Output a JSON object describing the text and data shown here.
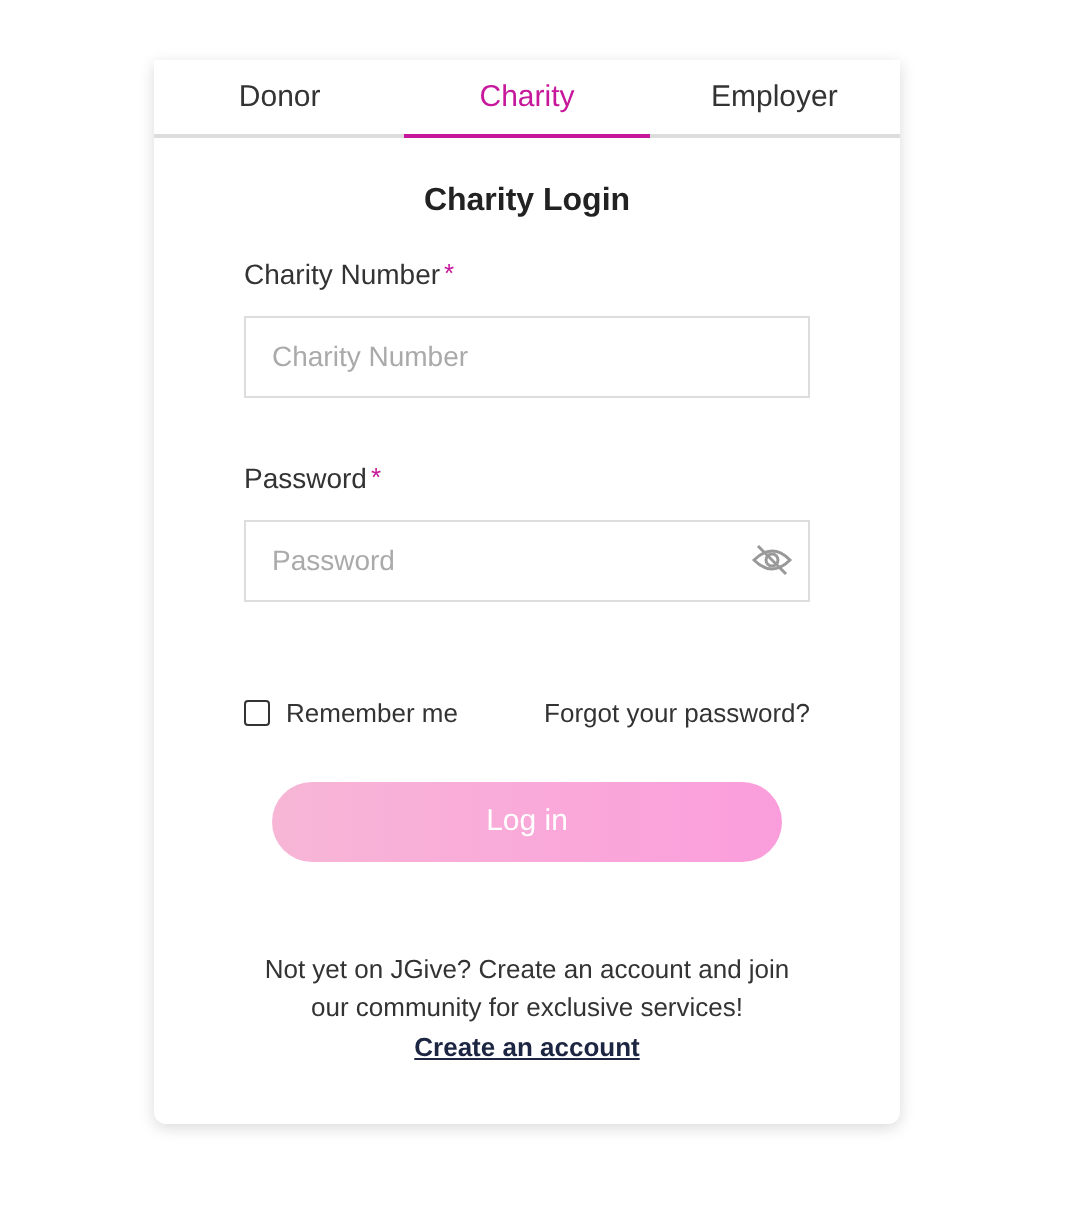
{
  "tabs": [
    {
      "label": "Donor",
      "selected": false
    },
    {
      "label": "Charity",
      "selected": true
    },
    {
      "label": "Employer",
      "selected": false
    }
  ],
  "title": "Charity Login",
  "fields": [
    {
      "label": "Charity Number",
      "required_mark": "*",
      "placeholder": "Charity Number",
      "kind": "text"
    },
    {
      "label": "Password",
      "required_mark": "*",
      "placeholder": "Password",
      "kind": "password"
    }
  ],
  "remember": {
    "label": "Remember me",
    "checked": false
  },
  "forgot_link": "Forgot your password?",
  "login_button": {
    "label": "Log in",
    "disabled": true
  },
  "signup_text": "Not yet on JGive? Create an account and join our community for exclusive services!",
  "signup_link": "Create an account"
}
